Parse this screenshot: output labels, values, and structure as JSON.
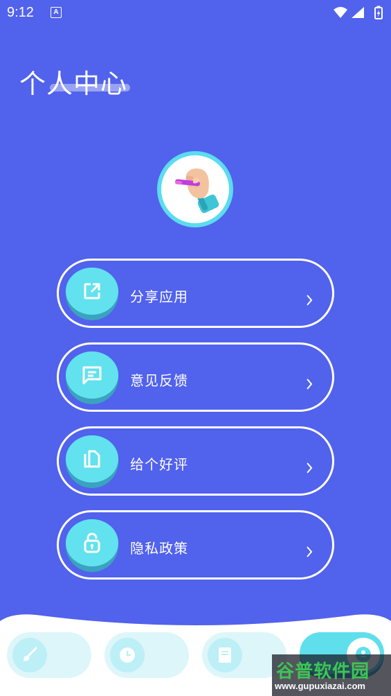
{
  "status_bar": {
    "time": "9:12",
    "notif_icon": "A"
  },
  "page": {
    "title": "个人中心"
  },
  "menu": [
    {
      "label": "分享应用",
      "icon": "share-icon"
    },
    {
      "label": "意见反馈",
      "icon": "feedback-icon"
    },
    {
      "label": "给个好评",
      "icon": "copy-icon"
    },
    {
      "label": "隐私政策",
      "icon": "lock-icon"
    }
  ],
  "bottom_nav": [
    {
      "icon": "brush-icon",
      "active": false
    },
    {
      "icon": "clock-icon",
      "active": false
    },
    {
      "icon": "book-icon",
      "active": false
    },
    {
      "icon": "person-icon",
      "active": true
    }
  ],
  "watermark": {
    "main": "谷普软件园",
    "url": "www.gupuxiazai.com"
  },
  "colors": {
    "background": "#5162ec",
    "accent": "#62e2ee",
    "accent_dark": "#3aa3c0"
  }
}
